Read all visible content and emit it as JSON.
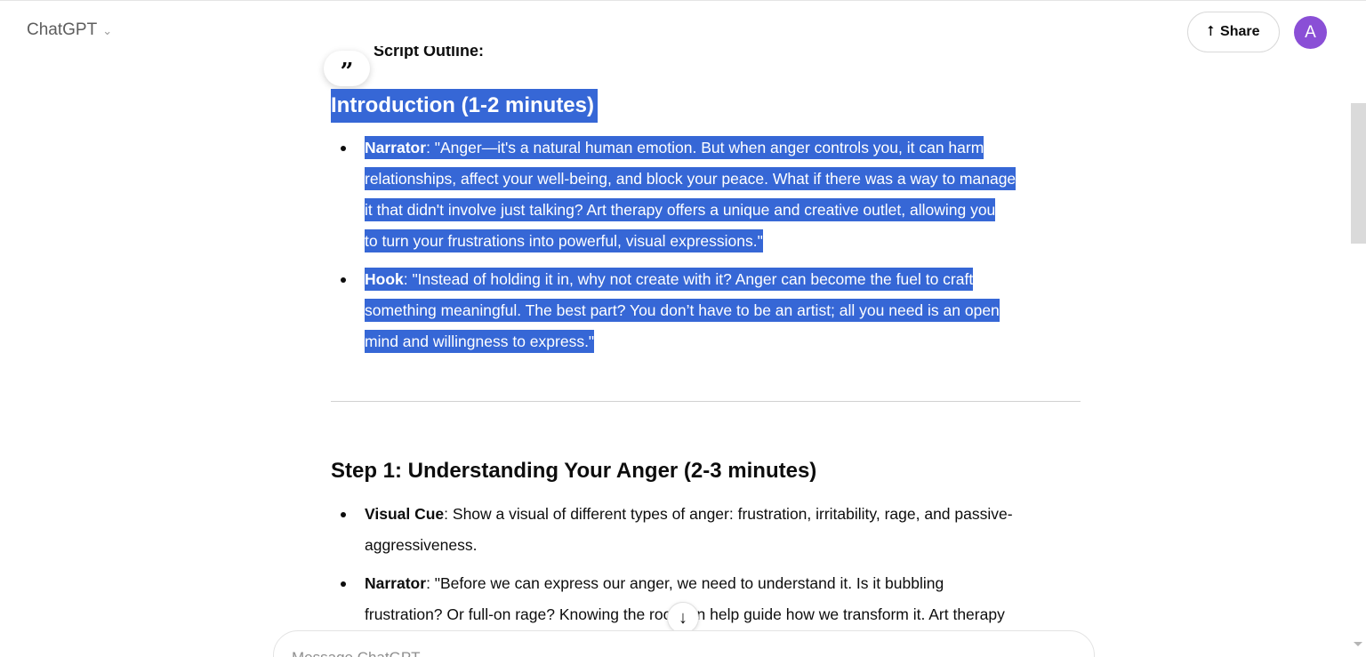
{
  "header": {
    "model_label": "ChatGPT",
    "share_label": "Share",
    "avatar_initial": "A"
  },
  "content": {
    "cut_heading": "Script Outline:",
    "intro_heading": "Introduction (1-2 minutes)",
    "intro_items": [
      {
        "label": "Narrator",
        "lines": [
          ": \"Anger—it's a natural human emotion. But when anger controls you, it can harm",
          "relationships, affect your well-being, and block your peace. What if there was a way to manage",
          "it that didn't involve just talking? Art therapy offers a unique and creative outlet, allowing you",
          "to turn your frustrations into powerful, visual expressions.\""
        ]
      },
      {
        "label": "Hook",
        "lines": [
          ": \"Instead of holding it in, why not create with it? Anger can become the fuel to craft",
          "something meaningful. The best part? You don’t have to be an artist; all you need is an open",
          "mind and willingness to express.\""
        ]
      }
    ],
    "step1_heading": "Step 1: Understanding Your Anger (2-3 minutes)",
    "step1_items": [
      {
        "label": "Visual Cue",
        "lines": [
          ": Show a visual of different types of anger: frustration, irritability, rage, and passive-",
          "aggressiveness."
        ]
      },
      {
        "label": "Narrator",
        "lines": [
          ": \"Before we can express our anger, we need to understand it. Is it bubbling",
          "frustration? Or full-on rage? Knowing the root can help guide how we transform it. Art therapy"
        ]
      }
    ]
  },
  "composer": {
    "placeholder": "Message ChatGPT"
  },
  "colors": {
    "selection": "#3667d6",
    "avatar": "#8a4fd6"
  },
  "icons": {
    "quote": "quote-icon",
    "share": "share-icon",
    "chevron": "chevron-down-icon",
    "scroll": "arrow-down-icon"
  }
}
